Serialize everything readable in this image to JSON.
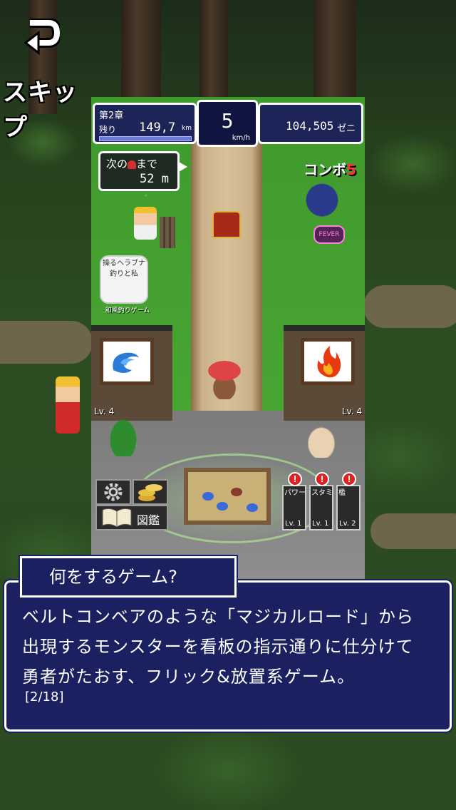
{
  "skip": {
    "label": "スキップ"
  },
  "hud": {
    "chapter": "第2章",
    "remaining_label": "残り",
    "remaining_value": "149,7",
    "remaining_unit": "km",
    "speed_value": "5",
    "speed_unit": "km/h",
    "money_value": "104,505",
    "money_unit": "ゼニ"
  },
  "next_bell": {
    "label_before": "次の",
    "label_after": "まで",
    "value": "52 m"
  },
  "combo": {
    "label": "コンボ",
    "count": "5"
  },
  "fever": "FEVER",
  "ad": {
    "icon_text": "操るヘラブナ釣りと私",
    "label": "和風釣りゲーム"
  },
  "gates": {
    "left_level": "Lv. 4",
    "right_level": "Lv. 4"
  },
  "menu": {
    "zukan": "図鑑"
  },
  "upgrades": [
    {
      "title": "パワー",
      "level": "Lv. 1"
    },
    {
      "title": "スタミナ",
      "level": "Lv. 1"
    },
    {
      "title": "檻",
      "level": "Lv. 2"
    }
  ],
  "dialog": {
    "title": "何をするゲーム?",
    "lines": [
      "ベルトコンベアのような「マジカルロード」から",
      "出現するモンスターを看板の指示通りに仕分けて",
      "勇者がたおす、フリック&放置系ゲーム。"
    ],
    "page": "[2/18]"
  },
  "colors": {
    "panel": "#1b2060",
    "grass": "#3f9a2c",
    "alert": "#e02020"
  }
}
